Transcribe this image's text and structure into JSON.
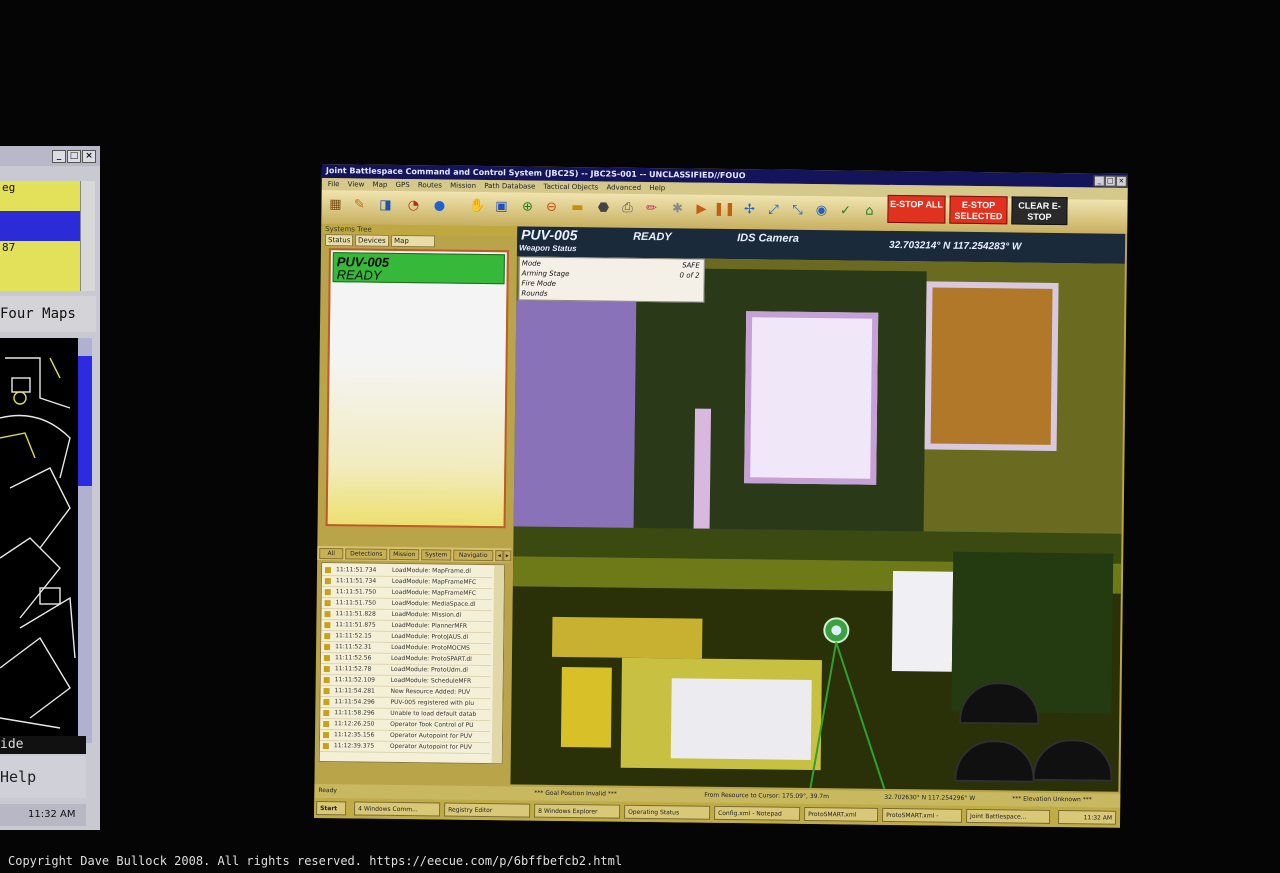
{
  "left_monitor": {
    "rows": [
      "eg",
      "",
      "87"
    ],
    "four_maps_label": "Four Maps",
    "side_label": "ide",
    "help_label": "Help",
    "clock": "11:32 AM"
  },
  "window": {
    "title": "Joint Battlespace Command and Control System (JBC2S) -- JBC2S-001 -- UNCLASSIFIED//FOUO",
    "menu": [
      "File",
      "View",
      "Map",
      "GPS",
      "Routes",
      "Mission",
      "Path Database",
      "Tactical Objects",
      "Advanced",
      "Help"
    ],
    "estop_all": "E-STOP ALL",
    "estop_selected": "E-STOP SELECTED",
    "clear_estop": "CLEAR E-STOP"
  },
  "systems_tree": {
    "header": "Systems Tree",
    "tabs": [
      "Status",
      "Devices",
      "Map Layers"
    ],
    "vehicle": {
      "name": "PUV-005",
      "state": "READY"
    }
  },
  "log": {
    "tabs": [
      "All",
      "Detections",
      "Mission",
      "System",
      "Navigatio"
    ],
    "entries": [
      {
        "time": "11:11:51.734",
        "msg": "LoadModule: MapFrame.dl"
      },
      {
        "time": "11:11:51.734",
        "msg": "LoadModule: MapFrameMFC"
      },
      {
        "time": "11:11:51.750",
        "msg": "LoadModule: MapFrameMFC"
      },
      {
        "time": "11:11:51.750",
        "msg": "LoadModule: MediaSpace.dl"
      },
      {
        "time": "11:11:51.828",
        "msg": "LoadModule: Mission.dl"
      },
      {
        "time": "11:11:51.875",
        "msg": "LoadModule: PlannerMFR"
      },
      {
        "time": "11:11:52.15",
        "msg": "LoadModule: ProtoJAUS.dl"
      },
      {
        "time": "11:11:52.31",
        "msg": "LoadModule: ProtoMOCMS"
      },
      {
        "time": "11:11:52.56",
        "msg": "LoadModule: ProtoSPART.dl"
      },
      {
        "time": "11:11:52.78",
        "msg": "LoadModule: ProtoUdm.dl"
      },
      {
        "time": "11:11:52.109",
        "msg": "LoadModule: ScheduleMFR"
      },
      {
        "time": "11:11:54.281",
        "msg": "New Resource Added: PUV"
      },
      {
        "time": "11:11:54.296",
        "msg": "PUV-005 registered with plu"
      },
      {
        "time": "11:11:58.296",
        "msg": "Unable to load default datab"
      },
      {
        "time": "11:12:26.250",
        "msg": "Operator Took Control of PU"
      },
      {
        "time": "11:12:35.156",
        "msg": "Operator Autopoint for PUV"
      },
      {
        "time": "11:12:39.375",
        "msg": "Operator Autopoint for PUV"
      }
    ]
  },
  "camera": {
    "vehicle": "PUV-005",
    "status": "READY",
    "camera_name": "IDS Camera",
    "coords": "32.703214° N 117.254283° W",
    "weapon_status": {
      "title": "Weapon Status",
      "rows": [
        {
          "label": "Mode",
          "value": "SAFE"
        },
        {
          "label": "Arming Stage",
          "value": "0 of 2"
        },
        {
          "label": "Fire Mode",
          "value": ""
        },
        {
          "label": "Rounds",
          "value": ""
        }
      ]
    }
  },
  "status_bar": {
    "left": "Ready",
    "mid1": "*** Goal Position Invalid ***",
    "mid2": "From Resource to Cursor: 175.09°, 39.7m",
    "coords": "32.702630° N 117.254296° W",
    "elevation": "*** Elevation Unknown ***"
  },
  "taskbar": {
    "start": "Start",
    "tasks": [
      "4 Windows Comm...",
      "Registry Editor",
      "8 Windows Explorer",
      "Operating Status",
      "Config.xml - Notepad",
      "ProtoSMART.xml",
      "ProtoSMART.xml -",
      "Joint Battlespace..."
    ],
    "clock": "11:32 AM"
  },
  "copyright": "Copyright Dave Bullock 2008. All rights reserved. https://eecue.com/p/6bffbefcb2.html",
  "colors": {
    "vehicle_ready": "#36b83a",
    "estop": "#e0321e",
    "clear_estop": "#2a2a2a",
    "panel_border": "#c05a2a"
  }
}
